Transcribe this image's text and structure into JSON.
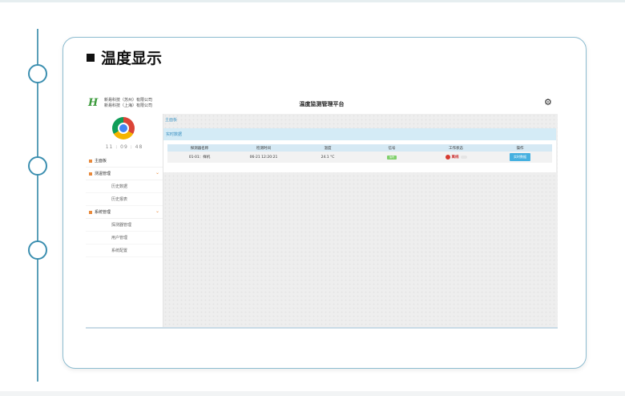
{
  "slide": {
    "title": "温度显示"
  },
  "app": {
    "logo": "H",
    "company_lines": [
      "新易科技（苏州）有限公司",
      "新易科技（上海）有限公司"
    ],
    "system_title": "温度监测管理平台",
    "clock": "11 : 09 : 48",
    "menu": {
      "dashboard": "主面板",
      "monitor": "测温管理",
      "monitor_subs": [
        "历史数据",
        "历史报表"
      ],
      "system": "系统管理",
      "system_subs": [
        "探测器管理",
        "用户管理",
        "系统配置"
      ]
    },
    "breadcrumb": "主面板",
    "panel_title": "实时数据",
    "table": {
      "headers": [
        "探测器名称",
        "检测时间",
        "温度",
        "信号",
        "工作状态",
        "操作"
      ],
      "rows": [
        {
          "name": "01-01：样机",
          "time": "06-21 12:20:21",
          "temp": "24.1 °C",
          "signal": "信号",
          "status": "离线",
          "action": "实时数据"
        }
      ]
    }
  },
  "colors": {
    "accent": "#3c8fb0",
    "table_header": "#d5e9f4",
    "offline": "#d63a2f",
    "signal": "#7fd06b",
    "button": "#45b0e0"
  }
}
